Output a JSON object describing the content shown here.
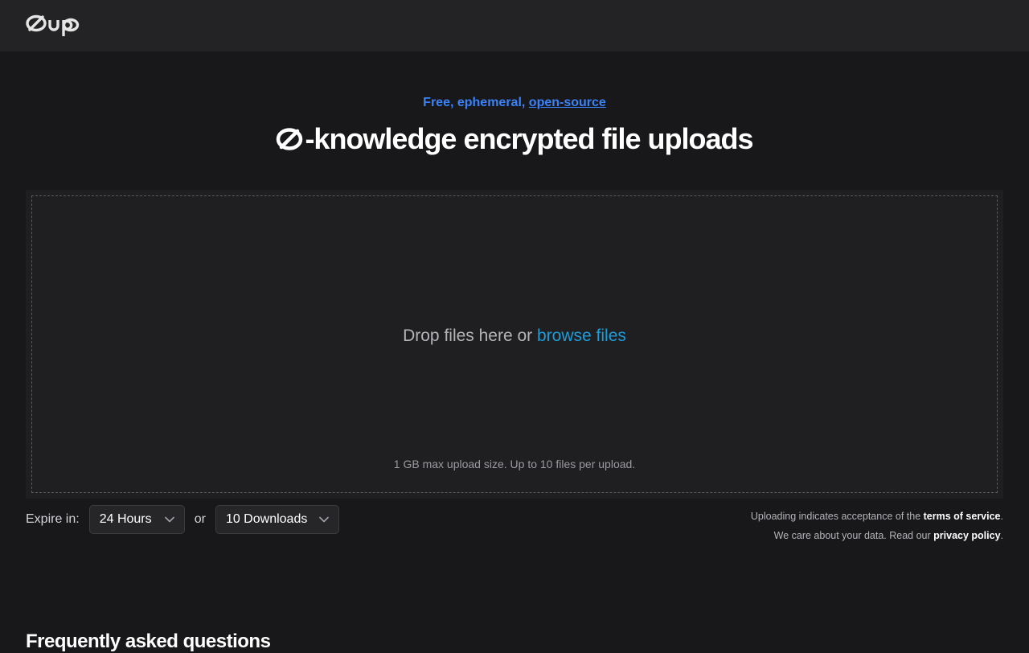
{
  "header": {
    "logo_text": "Øup"
  },
  "hero": {
    "tagline_prefix": "Free, ephemeral, ",
    "tagline_link": "open-source",
    "headline": "-knowledge encrypted file uploads"
  },
  "dropzone": {
    "prompt": "Drop files here or ",
    "browse_link": "browse files",
    "limit_note": "1 GB max upload size. Up to 10 files per upload."
  },
  "controls": {
    "expire_label": "Expire in:",
    "expire_value": "24 Hours",
    "or_label": "or",
    "downloads_value": "10 Downloads"
  },
  "legal": {
    "line1_prefix": "Uploading indicates acceptance of the ",
    "terms_link": "terms of service",
    "line1_suffix": ".",
    "line2_prefix": "We care about your data. Read our ",
    "privacy_link": "privacy policy",
    "line2_suffix": "."
  },
  "faq": {
    "title": "Frequently asked questions"
  },
  "colors": {
    "background": "#18181b",
    "header": "#232325",
    "accent_blue": "#3b82f6",
    "browse_link": "#1e9bd7"
  },
  "icons": {
    "logo": "zero-slash-icon",
    "headline_glyph": "zero-slash-icon",
    "select_chevron": "chevron-down-icon"
  }
}
